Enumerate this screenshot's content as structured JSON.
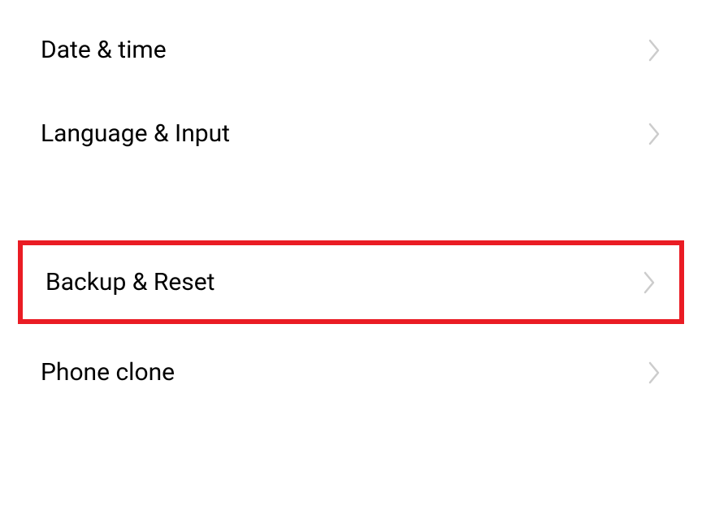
{
  "settings": {
    "items": [
      {
        "label": "Date & time"
      },
      {
        "label": "Language & Input"
      },
      {
        "label": "Backup & Reset"
      },
      {
        "label": "Phone clone"
      }
    ]
  },
  "highlight_color": "#ea1c24"
}
